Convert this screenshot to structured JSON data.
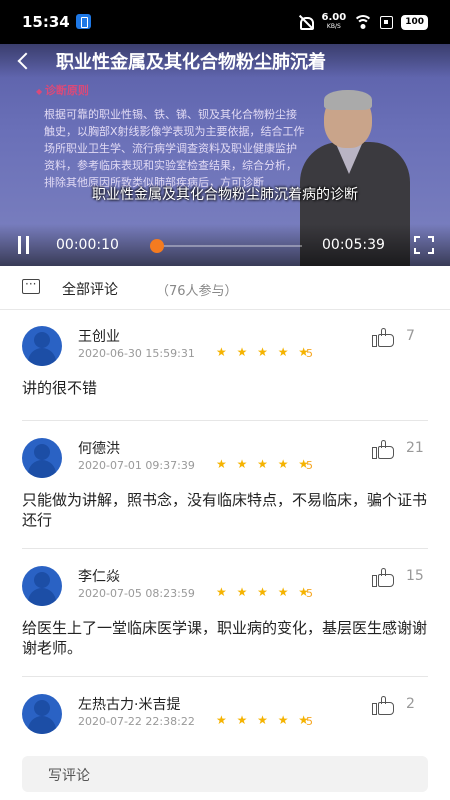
{
  "status_bar": {
    "time": "15:34",
    "net_speed_value": "6.00",
    "net_speed_unit": "KB/S",
    "battery": "100"
  },
  "video": {
    "title": "职业性金属及其化合物粉尘肺沉着",
    "subtitle": "职业性金属及其化合物粉尘肺沉着病的诊断",
    "slide_section": "诊断原则",
    "slide_body": "根据可靠的职业性锡、铁、锑、钡及其化合物粉尘接触史，以胸部X射线影像学表现为主要依据，结合工作场所职业卫生学、流行病学调查资料及职业健康监护资料，参考临床表现和实验室检查结果，综合分析，排除其他原因所致类似肺部疾病后，方可诊断",
    "current_time": "00:00:10",
    "duration": "00:05:39",
    "progress_fraction": 0.03,
    "accent_color": "#f47b20"
  },
  "comments_header": {
    "title": "全部评论",
    "count": "（76人参与）"
  },
  "comments": [
    {
      "name": "王创业",
      "date": "2020-06-30 15:59:31",
      "stars": "★ ★ ★ ★ ★",
      "score": "5",
      "likes": "7",
      "text": "讲的很不错"
    },
    {
      "name": "何德洪",
      "date": "2020-07-01 09:37:39",
      "stars": "★ ★ ★ ★ ★",
      "score": "5",
      "likes": "21",
      "text": "只能做为讲解，照书念，没有临床特点，不易临床，骗个证书还行"
    },
    {
      "name": "李仁焱",
      "date": "2020-07-05 08:23:59",
      "stars": "★ ★ ★ ★ ★",
      "score": "5",
      "likes": "15",
      "text": "给医生上了一堂临床医学课，职业病的变化，基层医生感谢谢谢老师。"
    },
    {
      "name": "左热古力·米吉提",
      "date": "2020-07-22 22:38:22",
      "stars": "★ ★ ★ ★ ★",
      "score": "5",
      "likes": "2",
      "text": ""
    }
  ],
  "write_comment": {
    "label": "写评论"
  }
}
